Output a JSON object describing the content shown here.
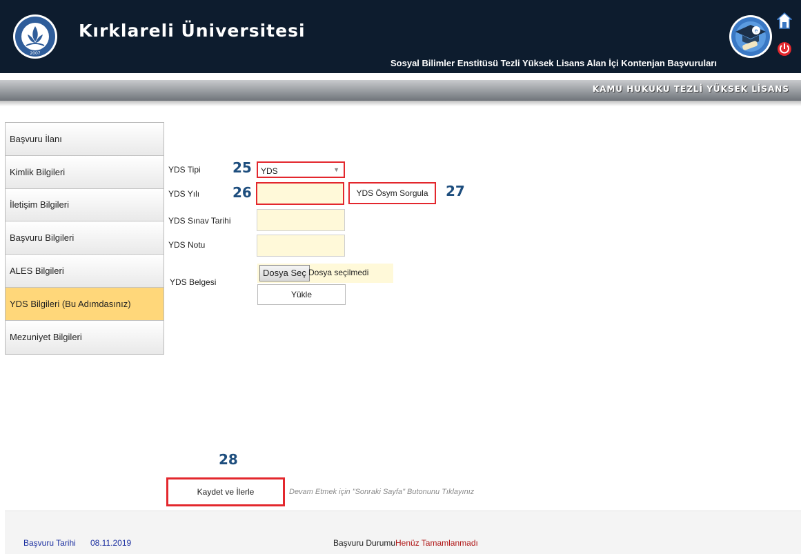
{
  "header": {
    "university_name": "Kırklareli Üniversitesi",
    "app_title": "Sosyal Bilimler Enstitüsü Tezli Yüksek Lisans Alan İçi Kontenjan Başvuruları",
    "logo_year": "2007"
  },
  "subheader": {
    "program_name": "KAMU HUKUKU TEZLİ YÜKSEK LİSANS"
  },
  "sidebar": {
    "items": [
      {
        "label": "Başvuru İlanı"
      },
      {
        "label": "Kimlik Bilgileri"
      },
      {
        "label": "İletişim Bilgileri"
      },
      {
        "label": "Başvuru Bilgileri"
      },
      {
        "label": "ALES Bilgileri"
      },
      {
        "label": "YDS Bilgileri (Bu Adımdasınız)",
        "active": true
      },
      {
        "label": "Mezuniyet Bilgileri"
      }
    ]
  },
  "form": {
    "yds_tipi": {
      "label": "YDS Tipi",
      "value": "YDS"
    },
    "yds_yili": {
      "label": "YDS Yılı",
      "value": ""
    },
    "osym_button": "YDS Ösym Sorgula",
    "sinav_tarihi": {
      "label": "YDS Sınav Tarihi",
      "value": ""
    },
    "notu": {
      "label": "YDS Notu",
      "value": ""
    },
    "belgesi": {
      "label": "YDS Belgesi",
      "file_button": "Dosya Seç",
      "file_status": "Dosya seçilmedi",
      "upload_button": "Yükle"
    }
  },
  "annotations": {
    "a25": "25",
    "a26": "26",
    "a27": "27",
    "a28": "28"
  },
  "actions": {
    "save_button": "Kaydet ve İlerle",
    "hint": "Devam Etmek için \"Sonraki Sayfa\" Butonunu Tıklayınız"
  },
  "footer": {
    "date_label": "Başvuru Tarihi",
    "date_value": "08.11.2019",
    "status_label": "Başvuru Durumu",
    "status_value": "Henüz Tamamlanmadı"
  },
  "colors": {
    "header_bg": "#0d1c2e",
    "active_item": "#ffd77a",
    "highlight_border": "#e3272d",
    "annotation": "#1e4e7e",
    "input_bg": "#fff9d9",
    "footer_link": "#1b2fa0",
    "status_value": "#b01818"
  }
}
